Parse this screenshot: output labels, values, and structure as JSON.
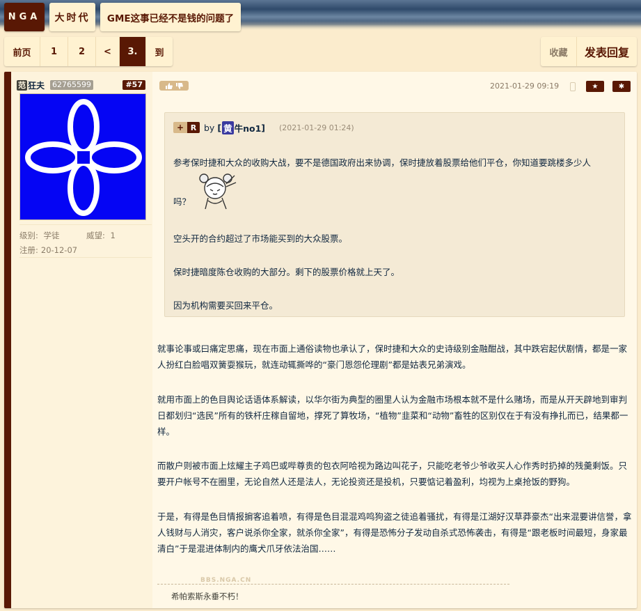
{
  "breadcrumbs": {
    "logo": "NGA",
    "forum": "大时代",
    "topic": "GME这事已经不是钱的问题了"
  },
  "pager": {
    "prev": "前页",
    "pages": [
      "1",
      "2"
    ],
    "arrow": "<",
    "current": "3.",
    "goto": "到"
  },
  "actions": {
    "favorite": "收藏",
    "reply": "发表回复"
  },
  "post": {
    "floor": "#57",
    "date": "2021-01-29 09:19",
    "user": {
      "badge": "范",
      "name": "狂夫",
      "uid": "62765599",
      "level_label": "级别:",
      "level": "学徒",
      "rep_label": "威望:",
      "rep": "1",
      "reg_label": "注册:",
      "reg": "20-12-07"
    },
    "quote": {
      "plus": "+",
      "r": "R",
      "by": "by",
      "user_open": "[",
      "user_badge": "黄",
      "user_rest": "牛no1",
      "user_close": "]",
      "time": "(2021-01-29 01:24)",
      "line1": "参考保时捷和大众的收购大战，要不是德国政府出来协调，保时捷放着股票给他们平仓，你知道要跳楼多少人",
      "line1b": "吗？",
      "line2": "空头开的合约超过了市场能买到的大众股票。",
      "line3": "保时捷暗度陈仓收购的大部分。剩下的股票价格就上天了。",
      "line4": "因为机构需要买回来平仓。"
    },
    "body": [
      "就事论事或曰痛定思痛，现在市面上通俗读物也承认了，保时捷和大众的史诗级别金融酣战，其中跌宕起伏剧情，都是一家人扮红白脸唱双簧耍猴玩，就连动辄撕哗的“豪门恩怨伦理剧”都是姑表兄弟演戏。",
      "就用市面上的色目舆论话语体系解读，以华尔街为典型的圈里人认为金融市场根本就不是什么赌场，而是从开天辟地到审判日都划归“选民”所有的铁杆庄稼自留地，撑死了算牧场，“植物”韭菜和“动物”畜牲的区别仅在于有没有挣扎而已，结果都一样。",
      "而散户则被市面上炫耀主子鸡巴或哔尊贵的包衣阿哈视为路边叫花子，只能吃老爷少爷收买人心作秀时扔掉的残羹剩饭。只要开户帐号不在圈里，无论自然人还是法人，无论投资还是投机，只要惦记着盈利，均视为上桌抢饭的野狗。",
      "于是，有得是色目情报掮客追着喷，有得是色目混混鸡鸣狗盗之徒追着骚扰，有得是江湖好汉草莽豪杰“出来混要讲信誉，拿人钱财与人消灾，客户说杀你全家，就杀你全家”，有得是恐怖分子发动自杀式恐怖袭击，有得是“跟老板时间最短，身家最清白”于是混进体制内的鹰犬爪牙依法治国……"
    ],
    "signature_watermark": "BBS.NGA.CN",
    "signature": "希帕索斯永垂不朽！"
  },
  "icons": {
    "like": "thumbs-up-icon",
    "dislike": "thumbs-down-icon",
    "phone": "phone-icon",
    "star": "star-icon",
    "gear": "gear-icon"
  },
  "colors": {
    "brand": "#591804",
    "background": "#fbeccd",
    "avatar_bg": "#0505f4",
    "text": "#10273f"
  }
}
